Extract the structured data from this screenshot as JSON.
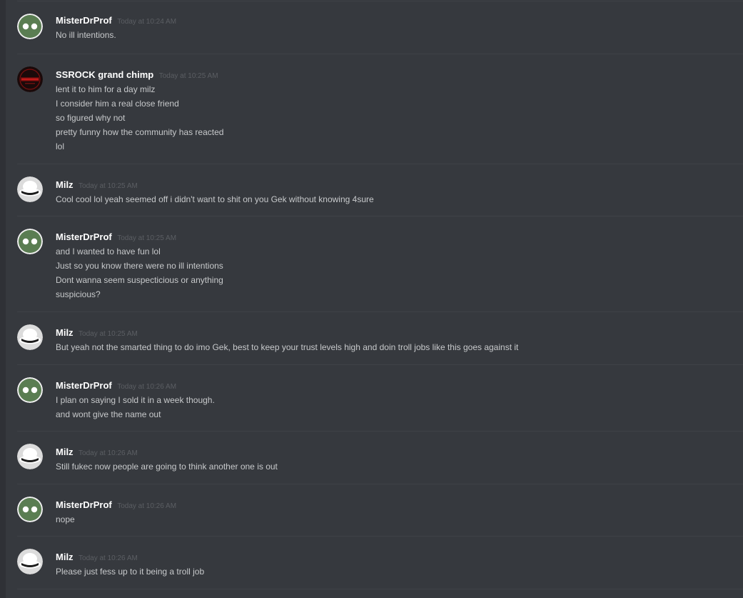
{
  "colors": {
    "background": "#36393e",
    "username": "#ffffff",
    "timestamp": "#5b5e63",
    "message_text": "#c7c9cb",
    "divider": "#3f4247"
  },
  "messages": [
    {
      "author": "MisterDrProf",
      "timestamp": "Today at 10:24 AM",
      "avatar": "green-two-dots-avatar",
      "lines": [
        "No ill intentions."
      ]
    },
    {
      "author": "SSROCK grand chimp",
      "timestamp": "Today at 10:25 AM",
      "avatar": "dark-red-emblem-avatar",
      "lines": [
        "lent it to him for a day milz",
        "I consider him a real close friend",
        "so figured why not",
        "pretty funny how the community has reacted",
        "lol"
      ]
    },
    {
      "author": "Milz",
      "timestamp": "Today at 10:25 AM",
      "avatar": "white-hat-avatar",
      "lines": [
        "Cool cool lol yeah seemed off i didn't want to shit on you Gek without knowing 4sure"
      ]
    },
    {
      "author": "MisterDrProf",
      "timestamp": "Today at 10:25 AM",
      "avatar": "green-two-dots-avatar",
      "lines": [
        "and I wanted to have fun lol",
        "Just so you know there were no ill intentions",
        "Dont wanna seem suspecticious or anything",
        "suspicious?"
      ]
    },
    {
      "author": "Milz",
      "timestamp": "Today at 10:25 AM",
      "avatar": "white-hat-avatar",
      "lines": [
        "But yeah not the smarted thing to do imo Gek, best to keep your trust levels high and doin troll jobs like this goes against it"
      ]
    },
    {
      "author": "MisterDrProf",
      "timestamp": "Today at 10:26 AM",
      "avatar": "green-two-dots-avatar",
      "lines": [
        "I plan on saying I sold it in a week though.",
        "and wont give the name out"
      ]
    },
    {
      "author": "Milz",
      "timestamp": "Today at 10:26 AM",
      "avatar": "white-hat-avatar",
      "lines": [
        "Still fukec now people are going to think another one is out"
      ]
    },
    {
      "author": "MisterDrProf",
      "timestamp": "Today at 10:26 AM",
      "avatar": "green-two-dots-avatar",
      "lines": [
        "nope"
      ]
    },
    {
      "author": "Milz",
      "timestamp": "Today at 10:26 AM",
      "avatar": "white-hat-avatar",
      "lines": [
        "Please just fess up to it being a troll job"
      ]
    }
  ]
}
